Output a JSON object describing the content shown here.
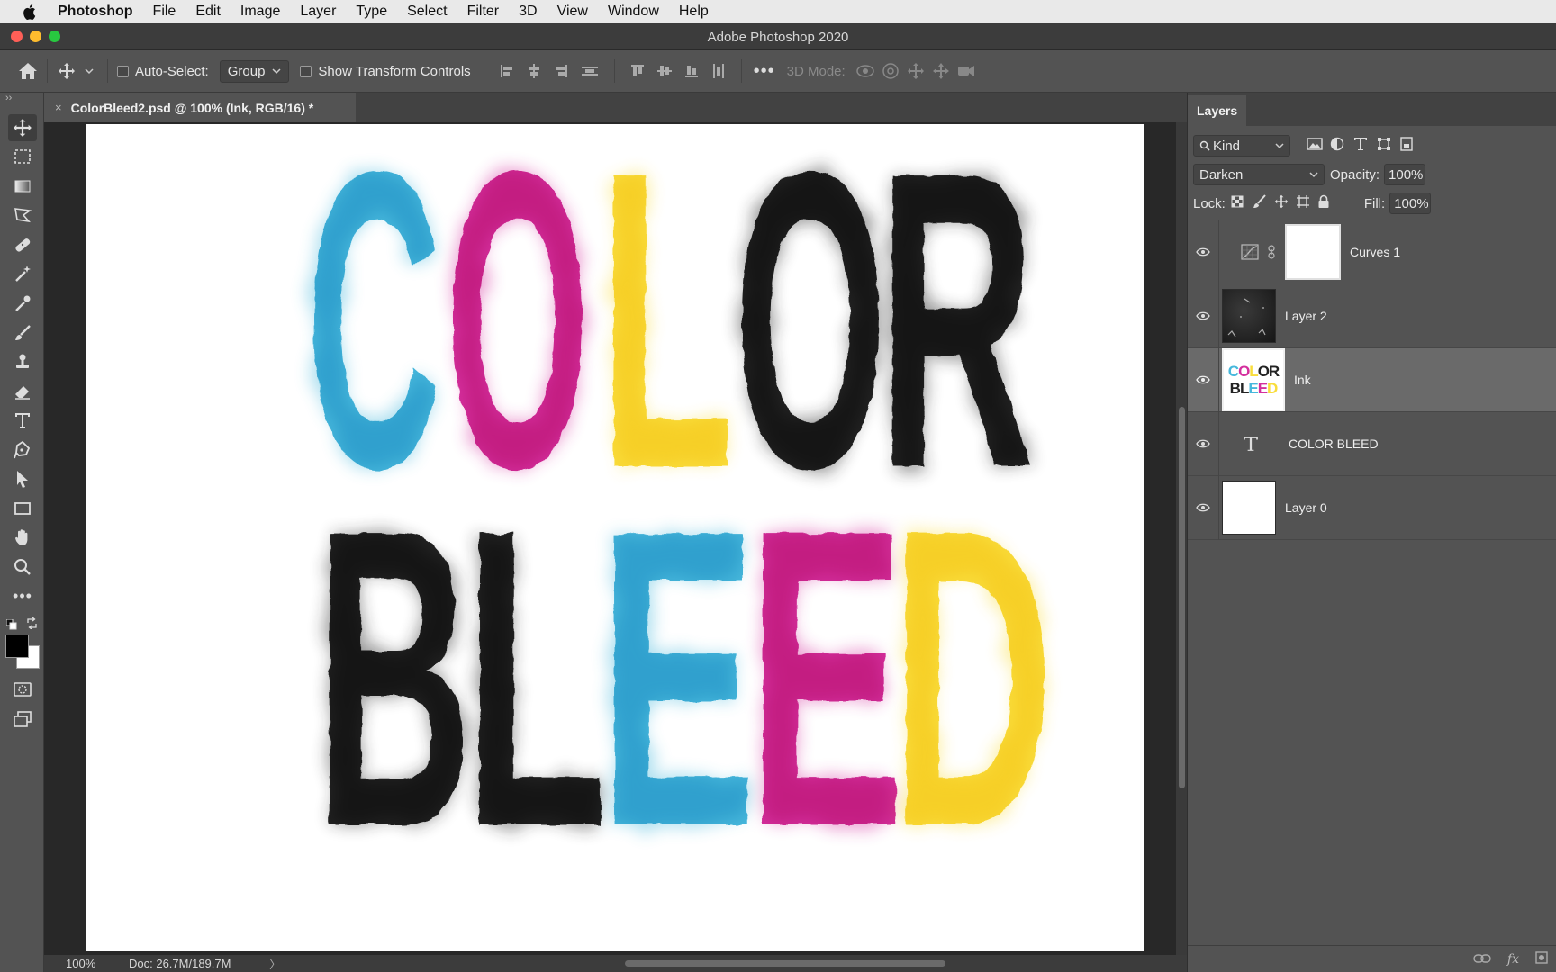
{
  "menubar": {
    "items": [
      "Photoshop",
      "File",
      "Edit",
      "Image",
      "Layer",
      "Type",
      "Select",
      "Filter",
      "3D",
      "View",
      "Window",
      "Help"
    ]
  },
  "window": {
    "title": "Adobe Photoshop 2020"
  },
  "options": {
    "auto_select_label": "Auto-Select:",
    "auto_select_checked": false,
    "auto_select_target": "Group",
    "show_transform_label": "Show Transform Controls",
    "show_transform_checked": false,
    "mode_3d_label": "3D Mode:"
  },
  "document": {
    "tab_title": "ColorBleed2.psd @ 100% (Ink, RGB/16) *",
    "artwork_line1": [
      "C",
      "O",
      "L",
      "O",
      "R"
    ],
    "artwork_line2": [
      "B",
      "L",
      "E",
      "E",
      "D"
    ]
  },
  "status": {
    "zoom": "100%",
    "doc": "Doc: 26.7M/189.7M",
    "arrow": "〉"
  },
  "layers_panel": {
    "tab": "Layers",
    "filter_kind": "Kind",
    "blend_mode": "Darken",
    "opacity_label": "Opacity:",
    "opacity_value": "100%",
    "lock_label": "Lock:",
    "fill_label": "Fill:",
    "fill_value": "100%",
    "layers": [
      {
        "name": "Curves 1",
        "type": "adjustment",
        "visible": true,
        "selected": false
      },
      {
        "name": "Layer 2",
        "type": "pixel-dark",
        "visible": true,
        "selected": false
      },
      {
        "name": "Ink",
        "type": "pixel-ink",
        "visible": true,
        "selected": true
      },
      {
        "name": "COLOR BLEED",
        "type": "text",
        "visible": true,
        "selected": false
      },
      {
        "name": "Layer 0",
        "type": "pixel-white",
        "visible": true,
        "selected": false
      }
    ],
    "ink_thumb_text": [
      "COLOR",
      "BLEED"
    ],
    "footer_icons": [
      "link-icon",
      "fx-icon",
      "mask-icon"
    ],
    "fx_label": "fx"
  },
  "colors": {
    "cyan": "#46b8dc",
    "magenta": "#d42f9d",
    "yellow": "#f9dd3b",
    "ink": "#232323",
    "foreground_swatch": "#000000",
    "background_swatch": "#ffffff"
  }
}
